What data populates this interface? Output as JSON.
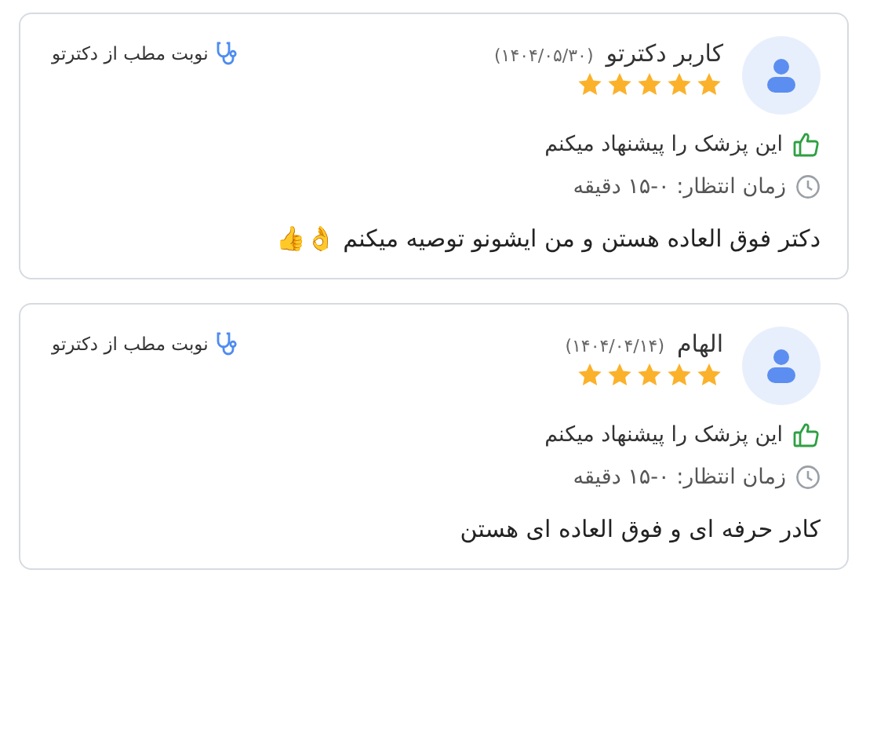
{
  "reviews": [
    {
      "author": "کاربر دکترتو",
      "date": "(۱۴۰۴/۰۵/۳۰)",
      "stars": 5,
      "source": "نوبت مطب از دکترتو",
      "recommended": true,
      "recommend_text": "این پزشک را پیشنهاد میکنم",
      "wait_time": "زمان انتظار: ۰-۱۵ دقیقه",
      "comment": "دکتر فوق العاده هستن و من ایشونو توصیه میکنم 👌👍"
    },
    {
      "author": "الهام",
      "date": "(۱۴۰۴/۰۴/۱۴)",
      "stars": 5,
      "source": "نوبت مطب از دکترتو",
      "recommended": true,
      "recommend_text": "این پزشک را پیشنهاد میکنم",
      "wait_time": "زمان انتظار: ۰-۱۵ دقیقه",
      "comment": "کادر حرفه ای و فوق العاده ای هستن"
    }
  ]
}
